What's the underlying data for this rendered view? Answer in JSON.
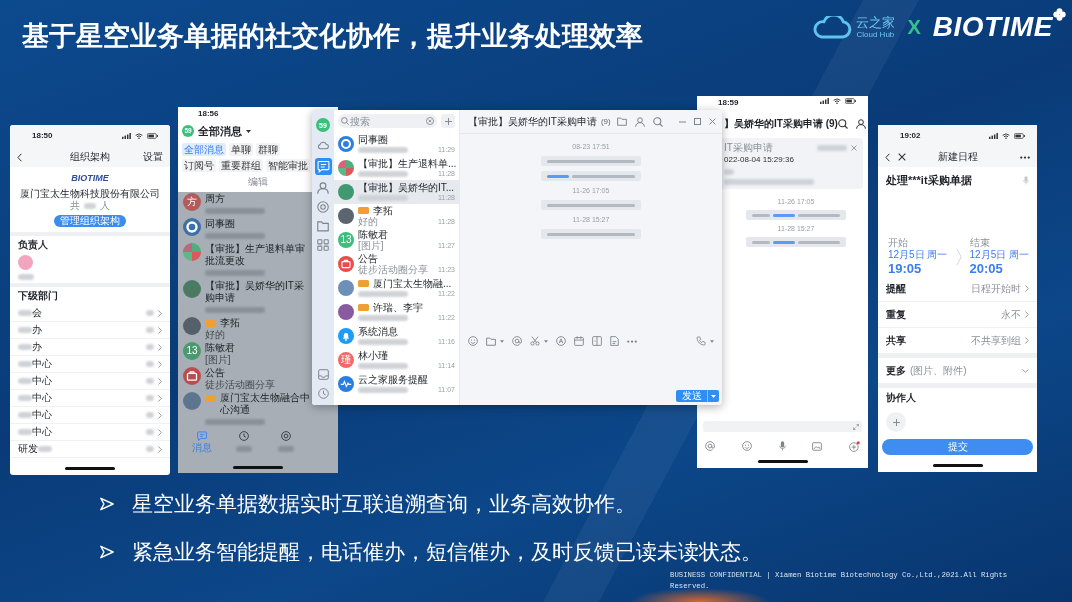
{
  "title": "基于星空业务单据的社交化协作，提升业务处理效率",
  "logo": {
    "product": "云之家",
    "product_en": "Cloud Hub",
    "joiner": "X",
    "brand": "BIOTIME"
  },
  "org_phone": {
    "time": "18:50",
    "title": "组织架构",
    "action": "设置",
    "company_logo": "BIOTIME",
    "company": "厦门宝太生物科技股份有限公司",
    "member_count": {
      "before": "共",
      "after": "人"
    },
    "manage_button": "管理组织架构",
    "leader_heading": "负责人",
    "dept_heading": "下级部门",
    "departments": [
      {
        "name": "会",
        "kind": "prefix"
      },
      {
        "name": "办",
        "kind": "prefix"
      },
      {
        "name": "办",
        "kind": "prefix"
      },
      {
        "name": "中心",
        "kind": "prefix"
      },
      {
        "name": "中心",
        "kind": "prefix"
      },
      {
        "name": "中心",
        "kind": "prefix"
      },
      {
        "name": "中心",
        "kind": "prefix"
      },
      {
        "name": "中心",
        "kind": "prefix"
      },
      {
        "name": "研发",
        "kind": "suffix"
      }
    ]
  },
  "messages_phone": {
    "time": "18:56",
    "badge": "59",
    "title": "全部消息",
    "filters": [
      {
        "label": "全部消息",
        "selected": true
      },
      {
        "label": "单聊",
        "selected": false
      },
      {
        "label": "群聊",
        "selected": false
      },
      {
        "label": "订阅号",
        "selected": false
      },
      {
        "label": "重要群组",
        "selected": false
      },
      {
        "label": "智能审批",
        "selected": false
      }
    ],
    "edit": "编辑",
    "conversations": [
      {
        "avatar": {
          "kind": "letter",
          "color": "#b35a5a",
          "initial": "方"
        },
        "name": "周方",
        "tagged": false
      },
      {
        "avatar": {
          "kind": "ring",
          "color": "#3d6fa8"
        },
        "name": "同事圈",
        "tagged": false
      },
      {
        "avatar": {
          "kind": "quad",
          "color": "#b86a7c"
        },
        "name": "【审批】生产退料单审批流更改",
        "tagged": false
      },
      {
        "avatar": {
          "kind": "photo",
          "color": "#4b7a62"
        },
        "name": "【审批】吴娇华的IT采购申请",
        "tagged": false
      },
      {
        "avatar": {
          "kind": "photo",
          "color": "#56606b"
        },
        "name": "李拓",
        "tagged": true,
        "preview": "好的"
      },
      {
        "avatar": {
          "kind": "letter",
          "color": "#4a9a6d",
          "initial": "13"
        },
        "name": "陈敏君",
        "tagged": false,
        "preview": "[图片]"
      },
      {
        "avatar": {
          "kind": "bag",
          "color": "#b84f4f"
        },
        "name": "公告",
        "tagged": false,
        "preview": "徒步活动圈分享"
      },
      {
        "avatar": {
          "kind": "photo",
          "color": "#5e7590"
        },
        "name": "厦门宝太生物融合中心沟通",
        "tagged": true
      }
    ],
    "nav": [
      {
        "label": "消息",
        "selected": true
      },
      {
        "selected": false
      },
      {
        "selected": false
      }
    ]
  },
  "desktop": {
    "badge": "59",
    "rail": [
      {
        "selected": false
      },
      {
        "selected": true
      },
      {
        "selected": false
      },
      {
        "selected": false
      },
      {
        "selected": false
      },
      {
        "selected": false
      }
    ],
    "search_placeholder": "搜索",
    "conversations": [
      {
        "avatar": {
          "kind": "ring",
          "color": "#2c7fe0"
        },
        "name": "同事圈",
        "time": "11:29",
        "tagged": false,
        "selected": false
      },
      {
        "avatar": {
          "kind": "quad",
          "color": "#e0607a"
        },
        "name": "【审批】生产退料单...",
        "time": "11:28",
        "tagged": false,
        "selected": false
      },
      {
        "avatar": {
          "kind": "photo",
          "color": "#3f9a72"
        },
        "name": "【审批】吴娇华的IT...",
        "time": "11:28",
        "tagged": false,
        "selected": true
      },
      {
        "avatar": {
          "kind": "photo",
          "color": "#5c6470"
        },
        "name": "李拓",
        "time": "11:28",
        "tagged": true,
        "preview": "好的",
        "selected": false
      },
      {
        "avatar": {
          "kind": "letter",
          "color": "#3bbf7a",
          "initial": "13"
        },
        "name": "陈敏君",
        "time": "11:27",
        "tagged": false,
        "preview": "[图片]",
        "selected": false
      },
      {
        "avatar": {
          "kind": "bag",
          "color": "#ea4b4b"
        },
        "name": "公告",
        "time": "11:23",
        "tagged": false,
        "preview": "徒步活动圈分享",
        "selected": false
      },
      {
        "avatar": {
          "kind": "photo",
          "color": "#6d8fb8"
        },
        "name": "厦门宝太生物融...",
        "time": "11:22",
        "tagged": true,
        "selected": false
      },
      {
        "avatar": {
          "kind": "photo",
          "color": "#8a5aa0"
        },
        "name": "许瑞、李宇",
        "time": "11:22",
        "tagged": true,
        "selected": false
      },
      {
        "avatar": {
          "kind": "bell",
          "color": "#1e9cf5"
        },
        "name": "系统消息",
        "time": "11:16",
        "tagged": false,
        "selected": false
      },
      {
        "avatar": {
          "kind": "letter",
          "color": "#f06a6a",
          "initial": "瑾"
        },
        "name": "林小瑾",
        "time": "11:14",
        "tagged": false,
        "selected": false
      },
      {
        "avatar": {
          "kind": "wave",
          "color": "#2a7de1"
        },
        "name": "云之家服务提醒",
        "time": "11:07",
        "tagged": false,
        "selected": false
      }
    ],
    "chat": {
      "title": "【审批】吴娇华的IT采购申请",
      "count": "(9)",
      "events": [
        {
          "kind": "time",
          "text": "08-23 17:51"
        },
        {
          "kind": "notice",
          "highlight": false
        },
        {
          "kind": "notice",
          "highlight": true
        },
        {
          "kind": "time",
          "text": "11-26 17:05"
        },
        {
          "kind": "notice",
          "highlight": false
        },
        {
          "kind": "time",
          "text": "11-28 15:27"
        },
        {
          "kind": "notice",
          "highlight": false
        }
      ],
      "send": "发送"
    }
  },
  "chat_phone": {
    "time": "18:59",
    "title": "】吴娇华的IT采购申请 (9)",
    "pinned": {
      "title": "IT采购申请",
      "date": "022-08-04 15:29:36"
    },
    "events": [
      {
        "kind": "time",
        "text": "11-26 17:05"
      },
      {
        "kind": "notice",
        "highlight": true
      },
      {
        "kind": "time",
        "text": "11-28 15:27"
      },
      {
        "kind": "notice",
        "highlight": true
      }
    ]
  },
  "schedule_phone": {
    "time": "19:02",
    "title": "新建日程",
    "subject": "处理***it采购单据",
    "start": {
      "label": "开始",
      "date": "12月5日 周一",
      "time": "19:05"
    },
    "end": {
      "label": "结束",
      "date": "12月5日 周一",
      "time": "20:05"
    },
    "settings": [
      {
        "label": "提醒",
        "value": "日程开始时"
      },
      {
        "label": "重复",
        "value": "永不"
      },
      {
        "label": "共享",
        "value": "不共享到组"
      }
    ],
    "more": {
      "label": "更多",
      "hint": "(图片、附件)"
    },
    "collaborators": "协作人",
    "submit": "提交"
  },
  "bullets": [
    "星空业务单据数据实时互联追溯查询，业务高效协作。",
    "紧急业务智能提醒，电话催办，短信催办，及时反馈已读未读状态。"
  ],
  "footer": "BUSINESS CONFIDENTIAL | Xiamen Biotime Biotechnology Co.,Ltd.,2021.All Rights Reserved."
}
